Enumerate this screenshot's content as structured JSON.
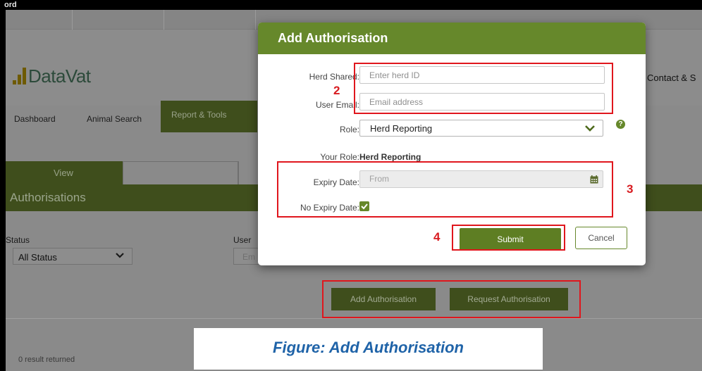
{
  "window": {
    "title": "ord"
  },
  "header": {
    "logo_text_1": "Data",
    "logo_text_2": "Vat",
    "contact": "Contact & S"
  },
  "nav": {
    "items": [
      "Dashboard",
      "Animal Search",
      "Report & Tools"
    ],
    "active": "Report & Tools"
  },
  "tabs": {
    "view": "View"
  },
  "section": {
    "title": "Authorisations"
  },
  "filters": {
    "status_label": "Status",
    "status_value": "All Status",
    "user_label": "User",
    "user_placeholder": "Em"
  },
  "actions": {
    "add": "Add Authorisation",
    "request": "Request Authorisation"
  },
  "results": {
    "text": "0 result returned"
  },
  "modal": {
    "title": "Add Authorisation",
    "herd_label": "Herd Shared:",
    "herd_placeholder": "Enter herd ID",
    "email_label": "User Email:",
    "email_placeholder": "Email address",
    "role_label": "Role:",
    "role_value": "Herd Reporting",
    "help_glyph": "?",
    "your_role_label": "Your Role:",
    "your_role_value": "Herd Reporting",
    "expiry_label": "Expiry Date:",
    "expiry_placeholder": "From",
    "no_expiry_label": "No Expiry Date:",
    "no_expiry_checked": true,
    "submit": "Submit",
    "cancel": "Cancel"
  },
  "annotations": {
    "n2": "2",
    "n3": "3",
    "n4": "4"
  },
  "caption": "Figure: Add Authorisation",
  "colors": {
    "accent": "#66882b",
    "dark_green": "#3f4e1c",
    "annotation_red": "#e0161d",
    "caption_blue": "#1f63a8"
  }
}
